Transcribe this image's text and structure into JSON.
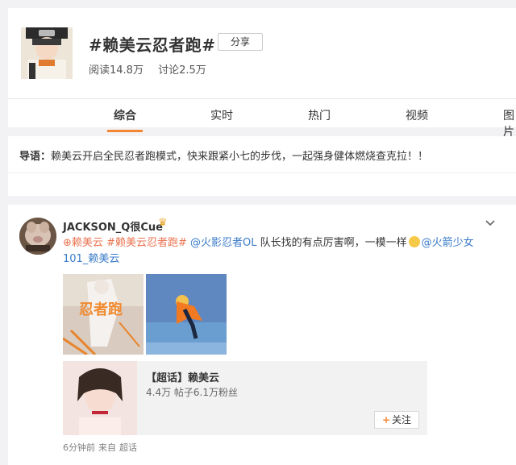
{
  "topic": {
    "title": "#赖美云忍者跑#",
    "share_label": "分享",
    "reads": "阅读14.8万",
    "discussions": "讨论2.5万"
  },
  "tabs": [
    {
      "label": "综合",
      "active": true
    },
    {
      "label": "实时",
      "active": false
    },
    {
      "label": "热门",
      "active": false
    },
    {
      "label": "视频",
      "active": false
    },
    {
      "label": "图片",
      "active": false
    }
  ],
  "intro": {
    "label": "导语：",
    "text": "赖美云开启全民忍者跑模式，快来跟紧小七的步伐，一起强身健体燃烧查克拉！！"
  },
  "post": {
    "username": "JACKSON_Q很Cue",
    "avatar_caption": "",
    "content": {
      "link_super": "赖美云",
      "hashtag": "#赖美云忍者跑#",
      "mention1": "@火影忍者OL",
      "text1": " 队长找的有点厉害啊，一模一样",
      "mention2": "@火箭少女101_赖美云"
    },
    "image1_text": "忍者跑",
    "super_topic": {
      "title": "【超话】赖美云",
      "stats": "4.4万 帖子6.1万粉丝",
      "follow_label": "关注"
    },
    "time": "6分钟前",
    "source_prefix": "来自",
    "source": "超话"
  },
  "colors": {
    "accent": "#f38633",
    "link": "#eb7350",
    "mention": "#3a7bc8"
  }
}
